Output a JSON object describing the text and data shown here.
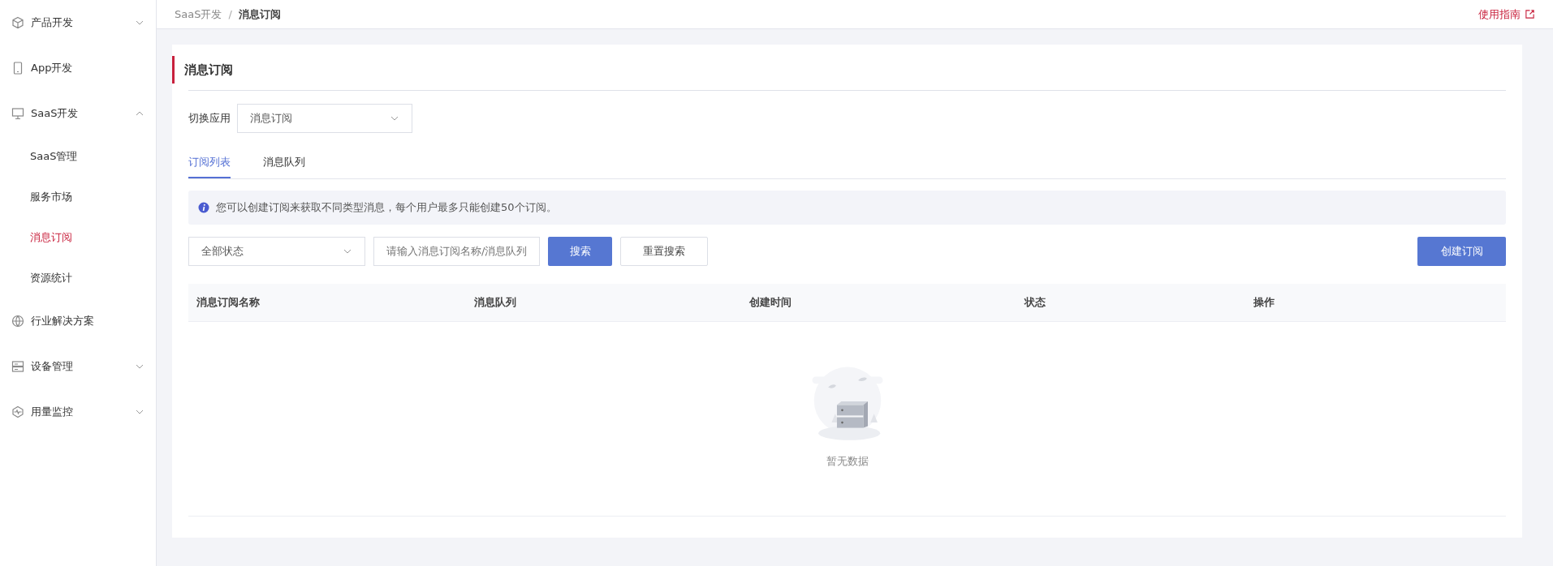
{
  "sidebar": {
    "items": [
      {
        "label": "产品开发",
        "expanded": false,
        "selected": false
      },
      {
        "label": "App开发",
        "selected": false
      },
      {
        "label": "SaaS开发",
        "expanded": true,
        "selected": false,
        "children": [
          {
            "label": "SaaS管理",
            "selected": false
          },
          {
            "label": "服务市场",
            "selected": false
          },
          {
            "label": "消息订阅",
            "selected": true
          },
          {
            "label": "资源统计",
            "selected": false
          }
        ]
      },
      {
        "label": "行业解决方案",
        "selected": false
      },
      {
        "label": "设备管理",
        "expanded": false,
        "selected": false
      },
      {
        "label": "用量监控",
        "expanded": false,
        "selected": false
      }
    ]
  },
  "breadcrumb": {
    "items": [
      "SaaS开发",
      "消息订阅"
    ],
    "separator": "/"
  },
  "guide_link": "使用指南",
  "page_title": "消息订阅",
  "app_switch": {
    "label": "切换应用",
    "value": "消息订阅"
  },
  "tabs": [
    {
      "label": "订阅列表",
      "selected": true
    },
    {
      "label": "消息队列",
      "selected": false
    }
  ],
  "info_text": "您可以创建订阅来获取不同类型消息，每个用户最多只能创建50个订阅。",
  "filters": {
    "status_select": "全部状态",
    "search_placeholder": "请输入消息订阅名称/消息队列",
    "search_button": "搜索",
    "reset_button": "重置搜索",
    "create_button": "创建订阅"
  },
  "table": {
    "columns": [
      "消息订阅名称",
      "消息队列",
      "创建时间",
      "状态",
      "操作"
    ],
    "empty_text": "暂无数据"
  }
}
